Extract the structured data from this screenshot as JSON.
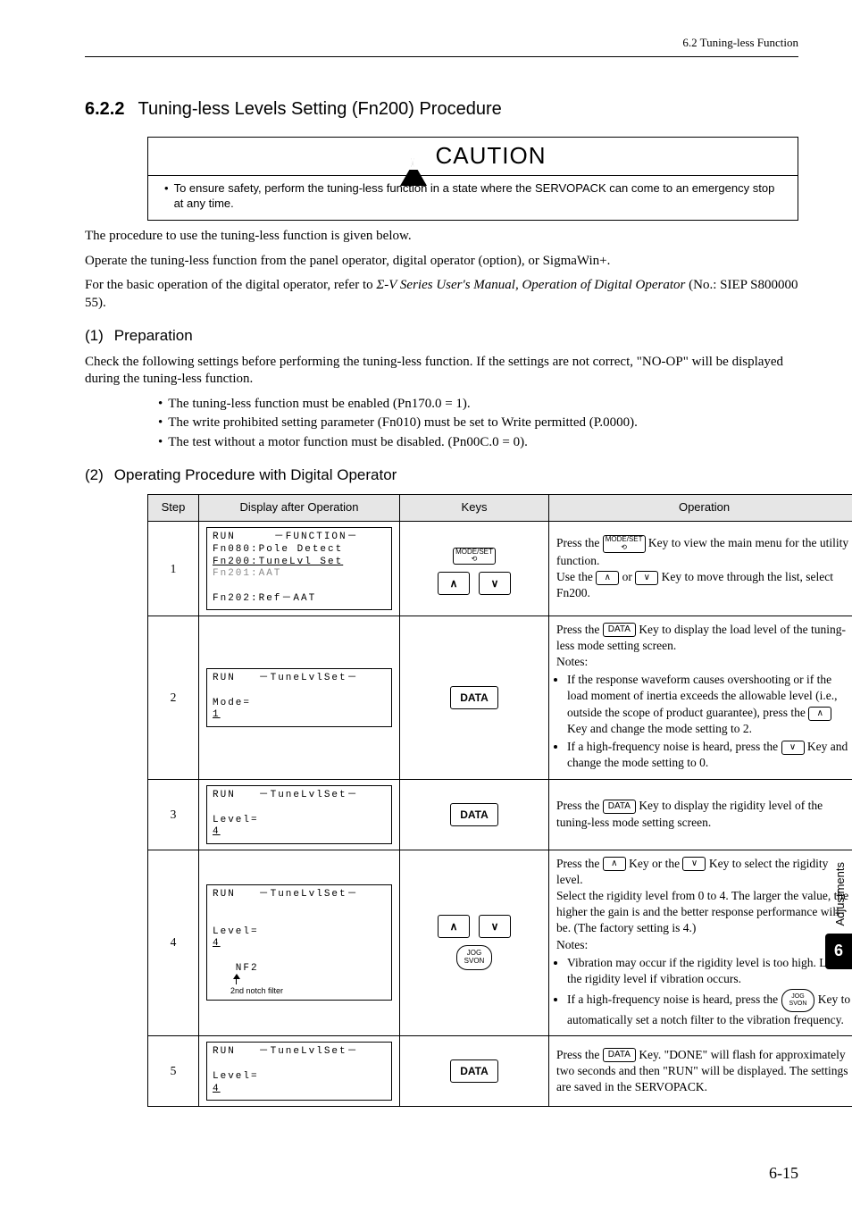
{
  "header": {
    "right": "6.2  Tuning-less Function"
  },
  "section": {
    "num": "6.2.2",
    "title": "Tuning-less Levels Setting (Fn200) Procedure"
  },
  "caution": {
    "title": "CAUTION",
    "body": "To ensure safety, perform the tuning-less function in a state where the SERVOPACK can come to an emergency stop at any time."
  },
  "intro": {
    "p1": "The procedure to use the tuning-less function is given below.",
    "p2": "Operate the tuning-less function from the panel operator, digital operator (option), or SigmaWin+.",
    "p3a": "For the basic operation of the digital operator, refer to ",
    "p3i": "Σ-V Series User's Manual, Operation of Digital Operator",
    "p3b": " (No.: SIEP S800000 55)."
  },
  "sub1": {
    "num": "(1)",
    "title": "Preparation",
    "lead": "Check the following settings before performing the tuning-less function. If the settings are not correct, \"NO-OP\" will be displayed during the tuning-less function.",
    "b1": "The tuning-less function must be enabled (Pn170.0 = 1).",
    "b2": "The write prohibited setting parameter (Fn010) must be set to Write permitted (P.0000).",
    "b3": "The test without a motor function must be disabled. (Pn00C.0 = 0)."
  },
  "sub2": {
    "num": "(2)",
    "title": "Operating Procedure with Digital Operator"
  },
  "table": {
    "headers": {
      "step": "Step",
      "disp": "Display after Operation",
      "keys": "Keys",
      "op": "Operation"
    },
    "rows": {
      "r1": {
        "step": "1",
        "lcd": "RUN     －FUNCTION－\nFn080:Pole Detect\nFn200:TuneLvl Set\nFn201:AAT\nFn202:Ref－AAT",
        "keys": {
          "modeset": "MODE/SET",
          "up": "∧",
          "down": "∨"
        },
        "op_a": "Press the ",
        "op_key1": "MODE/SET",
        "op_b": " Key to view the main menu for the utility function.",
        "op_c": "Use the ",
        "op_key2": "∧",
        "op_d": " or ",
        "op_key3": "∨",
        "op_e": " Key to move through the list, select Fn200."
      },
      "r2": {
        "step": "2",
        "lcd": "RUN   －TuneLvlSet－\n\nMode=1",
        "keys": {
          "data": "DATA"
        },
        "op_a": "Press the ",
        "op_key1": "DATA",
        "op_b": " Key to display the load level of the tuning-less mode setting screen.",
        "notes_label": "Notes:",
        "li1_a": "If the response waveform causes overshooting or if the load moment of inertia exceeds the allowable level (i.e., outside the scope of product guarantee), press the ",
        "li1_key": "∧",
        "li1_b": " Key and change the mode setting to 2.",
        "li2_a": "If a high-frequency noise is heard, press the ",
        "li2_key": "∨",
        "li2_b": " Key and change the mode setting to 0."
      },
      "r3": {
        "step": "3",
        "lcd": "RUN   －TuneLvlSet－\n\nLevel=4",
        "keys": {
          "data": "DATA"
        },
        "op_a": "Press the ",
        "op_key1": "DATA",
        "op_b": " Key to display the rigidity level of the tuning-less mode setting screen."
      },
      "r4": {
        "step": "4",
        "lcd_l1": "RUN   －TuneLvlSet－",
        "lcd_l2": "Level=4",
        "lcd_l3": "NF2",
        "arrow_note": "2nd notch filter",
        "keys": {
          "up": "∧",
          "down": "∨",
          "jog": "JOG\nSVON"
        },
        "op_a": "Press the ",
        "op_key1": "∧",
        "op_b": " Key or the ",
        "op_key2": "∨",
        "op_c": " Key to select the rigidity level.",
        "op_d": "Select the rigidity level from 0 to 4. The larger the value, the higher the gain is and the better response performance will be. (The factory setting is 4.)",
        "notes_label": "Notes:",
        "li1": "Vibration may occur if the rigidity level is too high. Lower the rigidity level if vibration occurs.",
        "li2_a": "If a high-frequency noise is heard, press the ",
        "li2_key": "JOG SVON",
        "li2_b": " Key to automatically set a notch filter to the vibration frequency."
      },
      "r5": {
        "step": "5",
        "lcd": "RUN   －TuneLvlSet－\n\nLevel=4",
        "keys": {
          "data": "DATA"
        },
        "op_a": "Press the ",
        "op_key1": "DATA",
        "op_b": " Key. \"DONE\" will flash for approximately two seconds and then \"RUN\" will be displayed. The settings are saved in the SERVOPACK."
      }
    }
  },
  "sidetab": {
    "label": "Adjustments",
    "page": "6"
  },
  "footer": {
    "page": "6-15"
  },
  "chart_data": {
    "type": "table",
    "title": "Operating Procedure with Digital Operator",
    "columns": [
      "Step",
      "Display after Operation",
      "Keys",
      "Operation"
    ],
    "rows": [
      {
        "step": 1,
        "display": "RUN −FUNCTION− / Fn080:Pole Detect / Fn200:TuneLvl Set / Fn201:AAT / Fn202:Ref−AAT",
        "keys": [
          "MODE/SET",
          "∧",
          "∨"
        ],
        "operation": "Press MODE/SET to view main menu for utility function. Use ∧ or ∨ to move through list, select Fn200."
      },
      {
        "step": 2,
        "display": "RUN −TuneLvlSet− / Mode=1",
        "keys": [
          "DATA"
        ],
        "operation": "Press DATA to display load level of tuning-less mode setting screen. Notes: If overshoot or load moment of inertia exceeds allowable, press ∧ and change mode to 2. If high-frequency noise, press ∨ and change mode to 0."
      },
      {
        "step": 3,
        "display": "RUN −TuneLvlSet− / Level=4",
        "keys": [
          "DATA"
        ],
        "operation": "Press DATA to display rigidity level of tuning-less mode setting screen."
      },
      {
        "step": 4,
        "display": "RUN −TuneLvlSet− / Level=4 / NF2 (2nd notch filter)",
        "keys": [
          "∧",
          "∨",
          "JOG SVON"
        ],
        "operation": "Press ∧ or ∨ to select rigidity level 0–4 (factory 4). Higher value → higher gain/better response. Notes: Vibration may occur if level too high—lower it. If high-frequency noise, press JOG SVON to auto-set notch filter to vibration frequency."
      },
      {
        "step": 5,
        "display": "RUN −TuneLvlSet− / Level=4",
        "keys": [
          "DATA"
        ],
        "operation": "Press DATA. \"DONE\" flashes ~2 s then \"RUN\" displays. Settings saved in SERVOPACK."
      }
    ]
  }
}
